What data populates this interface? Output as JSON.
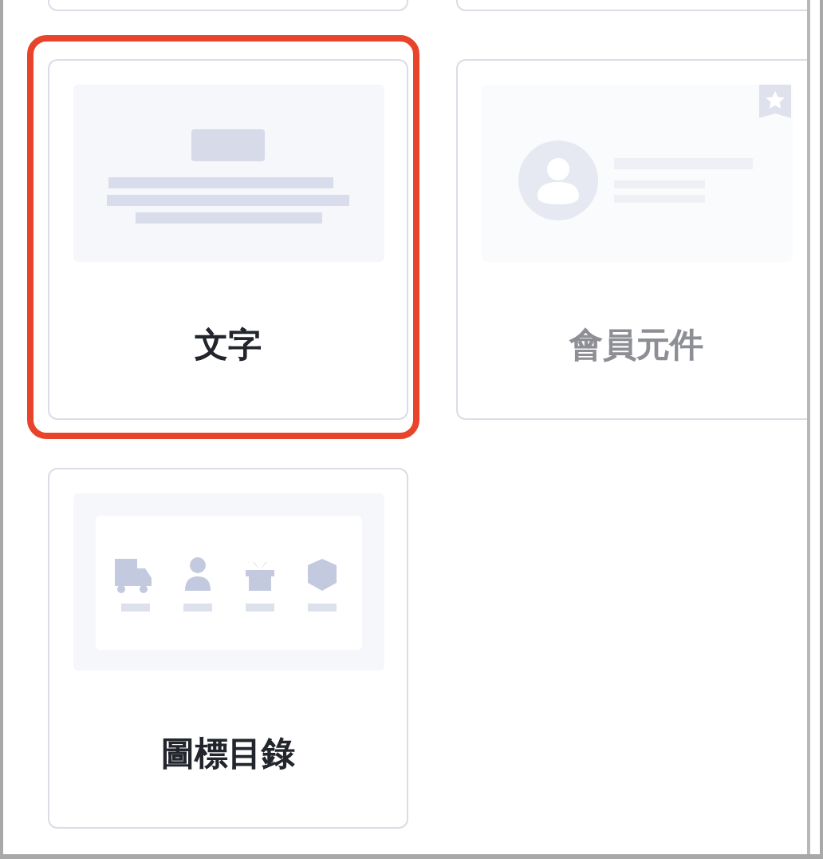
{
  "cards": [
    {
      "title": "文字",
      "kind": "text",
      "selected": true,
      "disabled": false,
      "bookmarked": false
    },
    {
      "title": "會員元件",
      "kind": "member",
      "selected": false,
      "disabled": true,
      "bookmarked": true
    },
    {
      "title": "圖標目錄",
      "kind": "icons",
      "selected": false,
      "disabled": false,
      "bookmarked": false
    }
  ]
}
